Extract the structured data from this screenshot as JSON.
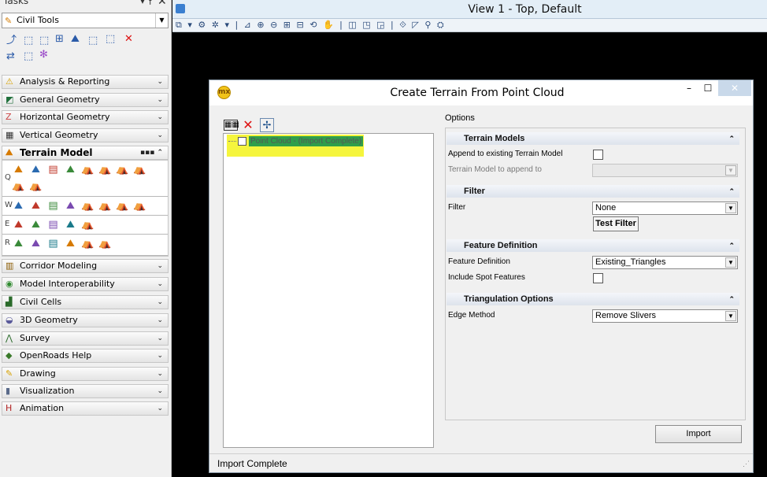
{
  "tasks_panel": {
    "title": "Tasks",
    "pin_glyph": "▾ ⫯",
    "close_glyph": "✕",
    "workflow": {
      "selected": "Civil Tools",
      "icon": "civil-tools-icon"
    },
    "quick_tool_icons": [
      "1",
      "2",
      "3",
      "4",
      "5",
      "6",
      "7",
      "8",
      "9",
      "0",
      "✻"
    ],
    "sections": [
      {
        "label": "Analysis & Reporting",
        "icon": "analysis-icon",
        "icon_glyph": "⚠",
        "color": "#d6a000"
      },
      {
        "label": "General Geometry",
        "icon": "general-geometry-icon",
        "icon_glyph": "◩",
        "color": "#1f6f3a"
      },
      {
        "label": "Horizontal Geometry",
        "icon": "horizontal-geometry-icon",
        "icon_glyph": "Z",
        "color": "#c44"
      },
      {
        "label": "Vertical Geometry",
        "icon": "vertical-geometry-icon",
        "icon_glyph": "▦",
        "color": "#333"
      },
      {
        "label": "Terrain Model",
        "icon": "terrain-model-icon",
        "icon_glyph": "⛰",
        "color": "#d67a00",
        "active": true
      },
      {
        "label": "Corridor Modeling",
        "icon": "corridor-icon",
        "icon_glyph": "▥",
        "color": "#8a5a00"
      },
      {
        "label": "Model Interoperability",
        "icon": "interoperability-icon",
        "icon_glyph": "◉",
        "color": "#2f8a2f"
      },
      {
        "label": "Civil Cells",
        "icon": "civil-cells-icon",
        "icon_glyph": "▟",
        "color": "#2a6a2a"
      },
      {
        "label": "3D Geometry",
        "icon": "3d-geometry-icon",
        "icon_glyph": "◒",
        "color": "#5a5a9a"
      },
      {
        "label": "Survey",
        "icon": "survey-icon",
        "icon_glyph": "⋀",
        "color": "#2a6a2a"
      },
      {
        "label": "OpenRoads Help",
        "icon": "help-icon",
        "icon_glyph": "◆",
        "color": "#3a7a2a"
      },
      {
        "label": "Drawing",
        "icon": "drawing-icon",
        "icon_glyph": "✎",
        "color": "#d6a000"
      },
      {
        "label": "Visualization",
        "icon": "visualization-icon",
        "icon_glyph": "▮",
        "color": "#5a6a8a"
      },
      {
        "label": "Animation",
        "icon": "animation-icon",
        "icon_glyph": "H",
        "color": "#b22222"
      }
    ],
    "terrain_rows": [
      {
        "label": "Q",
        "count": 10
      },
      {
        "label": "W",
        "count": 8
      },
      {
        "label": "E",
        "count": 5
      },
      {
        "label": "R",
        "count": 6
      }
    ]
  },
  "view": {
    "title": "View 1 - Top, Default",
    "toolbar_glyphs": "⧉ ▾ ⚙ ✲ ▾ | ⊿ ⊕ ⊖ ⊞ ⊟ ⟲ ✋ | ◫ ◳ ◲ | ⟐ ◸ ⚲ ⛭"
  },
  "dialog": {
    "title": "Create Terrain From Point Cloud",
    "logo_text": "mx",
    "min_glyph": "–",
    "max_glyph": "☐",
    "close_glyph": "✕",
    "tree_item": "Point Cloud - (Import Complete)",
    "options_label": "Options",
    "groups": {
      "terrain_models": "Terrain Models",
      "filter": "Filter",
      "feature_definition": "Feature Definition",
      "triangulation_options": "Triangulation Options"
    },
    "rows": {
      "append_label": "Append to existing Terrain Model",
      "append_to_label": "Terrain Model to append to",
      "append_to_value": "",
      "filter_label": "Filter",
      "filter_value": "None",
      "test_filter": "Test Filter",
      "feature_def_label": "Feature Definition",
      "feature_def_value": "Existing_Triangles",
      "spot_label": "Include Spot Features",
      "edge_label": "Edge Method",
      "edge_value": "Remove Slivers"
    },
    "import_button": "Import",
    "status": "Import Complete"
  },
  "colors": {
    "highlight": "#f5f53d",
    "tree_label_bg": "#2f9e4b",
    "close_button": "#c9d9ea"
  }
}
